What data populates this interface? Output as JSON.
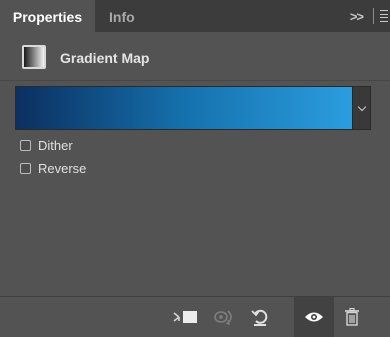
{
  "tabs": {
    "properties": "Properties",
    "info": "Info"
  },
  "header": {
    "icon": "gradient-map-adjustment-icon",
    "title": "Gradient Map"
  },
  "gradient": {
    "stops": [
      "#0c2f60",
      "#1571ad",
      "#2b9ddf"
    ]
  },
  "options": {
    "dither": {
      "label": "Dither",
      "checked": false
    },
    "reverse": {
      "label": "Reverse",
      "checked": false
    }
  },
  "toolbar": {
    "icons": [
      "clip-to-layer-icon",
      "view-previous-state-icon",
      "reset-icon",
      "visibility-eye-icon",
      "delete-trash-icon"
    ]
  },
  "colors": {
    "panel_bg": "#535353",
    "tabbar_bg": "#3c3c3c",
    "text": "#e0e0e0",
    "muted_text": "#a9a9a9"
  }
}
